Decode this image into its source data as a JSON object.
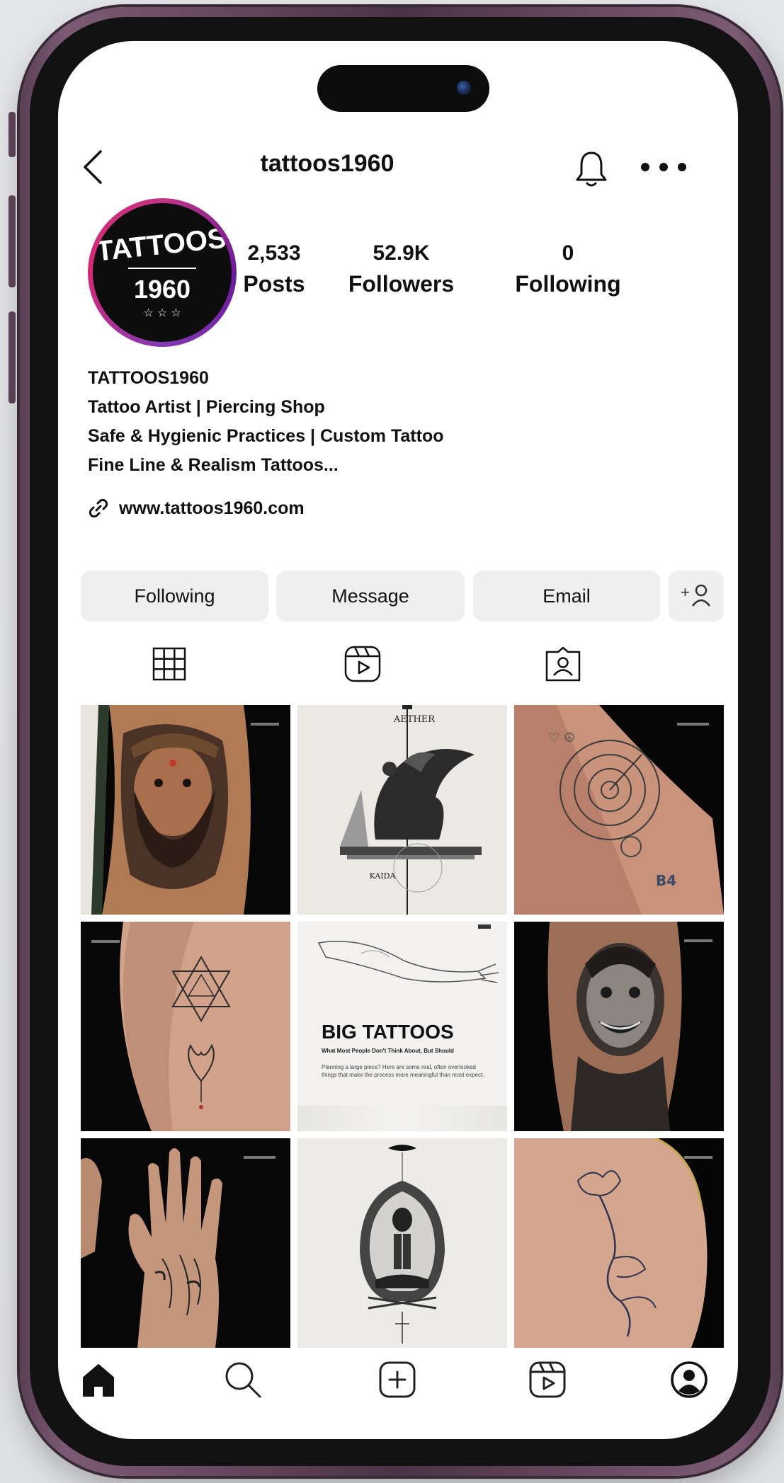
{
  "profile": {
    "username": "tattoos1960",
    "avatar_text_top": "TATTOOS",
    "avatar_text_bottom": "1960",
    "stats": [
      {
        "value": "2,533",
        "label": "Posts"
      },
      {
        "value": "52.9K",
        "label": "Followers"
      },
      {
        "value": "0",
        "label": "Following"
      }
    ],
    "bio": [
      "TATTOOS1960",
      "Tattoo Artist | Piercing Shop",
      "Safe & Hygienic Practices | Custom Tattoo",
      "Fine Line & Realism Tattoos..."
    ],
    "website": "www.tattoos1960.com"
  },
  "actions": {
    "following_label": "Following",
    "message_label": "Message",
    "email_label": "Email",
    "add_user_icon": "add-user-icon"
  },
  "tabs": [
    "grid-icon",
    "reels-icon",
    "tagged-icon"
  ],
  "posts": [
    {
      "kind": "photo",
      "subject": "portrait-arm-tattoo"
    },
    {
      "kind": "artwork",
      "top_text": "AETHER",
      "bottom_text": "KAIDA"
    },
    {
      "kind": "photo",
      "subject": "clock-arm-tattoo"
    },
    {
      "kind": "photo",
      "subject": "geometric-lotus-tattoo"
    },
    {
      "kind": "text-card",
      "headline": "BIG TATTOOS",
      "subhead": "What Most People Don't Think About, But Should",
      "body": "Planning a large piece? Here are some real, often overlooked things that make the process more meaningful than most expect."
    },
    {
      "kind": "photo",
      "subject": "joker-arm-tattoo"
    },
    {
      "kind": "photo",
      "subject": "hand-tattoo"
    },
    {
      "kind": "artwork",
      "subject": "skeleton-wings-design"
    },
    {
      "kind": "photo",
      "subject": "floral-shoulder-tattoo"
    }
  ],
  "nav": [
    "home-icon",
    "search-icon",
    "create-icon",
    "reels-icon",
    "profile-icon"
  ],
  "colors": {
    "text": "#111111",
    "button_bg": "#efefef",
    "frame": "#5a3f55",
    "story_ring": "#c13584"
  }
}
